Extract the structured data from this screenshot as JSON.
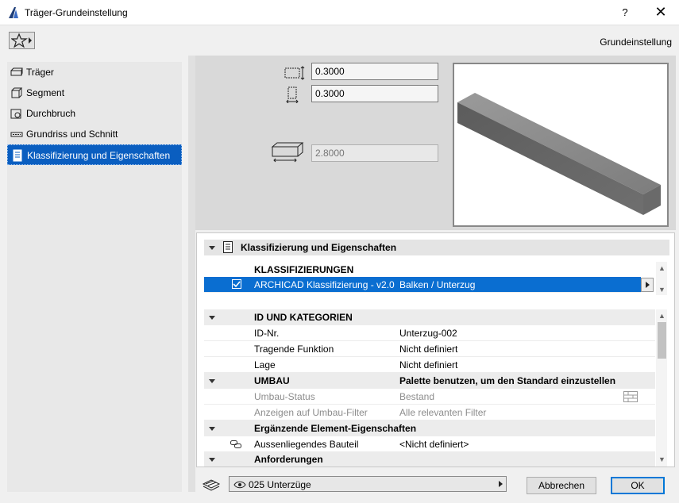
{
  "window": {
    "title": "Träger-Grundeinstellung",
    "help_label": "?",
    "close_label": "✕"
  },
  "toolbar": {
    "favorites_icon": "star-icon",
    "preset_label": "Grundeinstellung"
  },
  "left_panel": {
    "items": [
      {
        "label": "Träger",
        "icon": "beam-icon"
      },
      {
        "label": "Segment",
        "icon": "segment-icon"
      },
      {
        "label": "Durchbruch",
        "icon": "opening-icon"
      },
      {
        "label": "Grundriss und Schnitt",
        "icon": "floorplan-icon"
      },
      {
        "label": "Klassifizierung und Eigenschaften",
        "icon": "document-icon"
      }
    ],
    "selected_index": 4
  },
  "dimensions": {
    "width": "0.3000",
    "height": "0.3000",
    "length": "2.8000"
  },
  "properties": {
    "section_title": "Klassifizierung und Eigenschaften",
    "classification_header": "KLASSIFIZIERUNGEN",
    "classification_row": {
      "name": "ARCHICAD Klassifizierung - v2.0",
      "value": "Balken / Unterzug"
    },
    "id_group": "ID UND KATEGORIEN",
    "id_rows": [
      {
        "name": "ID-Nr.",
        "value": "Unterzug-002"
      },
      {
        "name": "Tragende Funktion",
        "value": "Nicht definiert"
      },
      {
        "name": "Lage",
        "value": "Nicht definiert"
      }
    ],
    "umbau_group": {
      "name": "UMBAU",
      "value": "Palette benutzen, um den Standard einzustellen"
    },
    "umbau_rows": [
      {
        "name": "Umbau-Status",
        "value": "Bestand"
      },
      {
        "name": "Anzeigen auf Umbau-Filter",
        "value": "Alle relevanten Filter"
      }
    ],
    "extra_group": "Ergänzende Element-Eigenschaften",
    "extra_rows": [
      {
        "name": "Aussenliegendes Bauteil",
        "value": "<Nicht definiert>"
      }
    ],
    "requirements_group": "Anforderungen"
  },
  "bottom": {
    "layer_label": "025 Unterzüge",
    "cancel_label": "Abbrechen",
    "ok_label": "OK"
  },
  "colors": {
    "selection": "#0a5ec0",
    "ok_border": "#0078d7"
  }
}
